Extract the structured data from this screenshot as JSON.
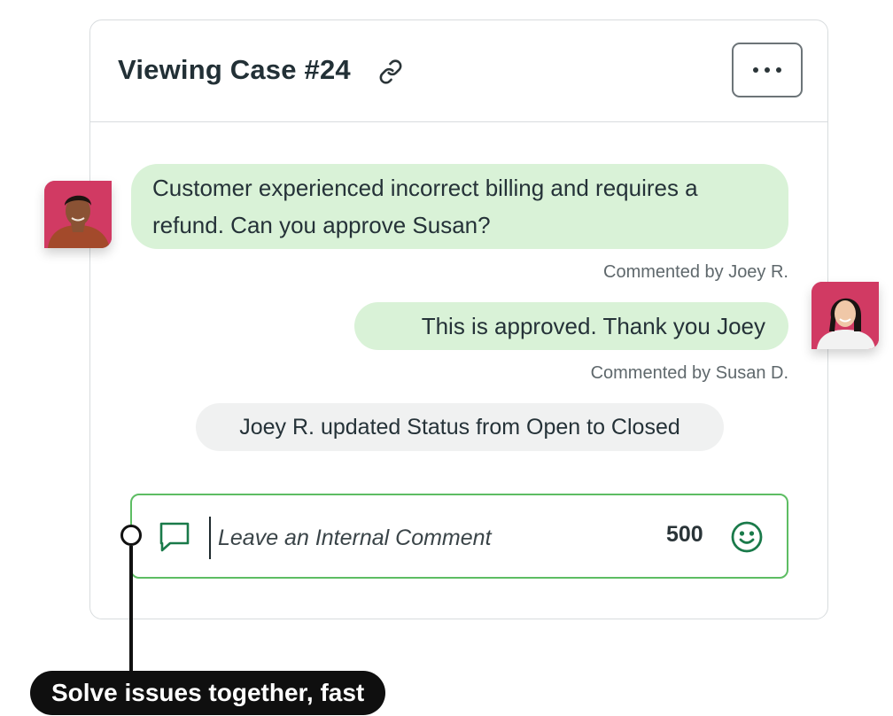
{
  "header": {
    "title": "Viewing Case #24",
    "link_icon": "link-icon",
    "more_icon": "more-horizontal-icon"
  },
  "messages": [
    {
      "text": "Customer experienced incorrect billing and requires a refund. Can you approve Susan?",
      "meta": "Commented by Joey R.",
      "author_avatar": "Joey R."
    },
    {
      "text": "This is approved. Thank you Joey",
      "meta": "Commented by Susan D.",
      "author_avatar": "Susan D."
    }
  ],
  "system_event": {
    "text": "Joey R. updated Status from Open to Closed"
  },
  "composer": {
    "icon": "chat-bubble-icon",
    "placeholder": "Leave an Internal Comment",
    "value": "",
    "char_count": "500",
    "emoji_icon": "smiley-icon"
  },
  "tagline": "Solve issues together, fast",
  "colors": {
    "bubble_green": "#d9f2d7",
    "accent_green": "#1a7a4a",
    "composer_border": "#5dbd63",
    "avatar_bg": "#d13a63",
    "system_pill": "#f0f1f1"
  }
}
